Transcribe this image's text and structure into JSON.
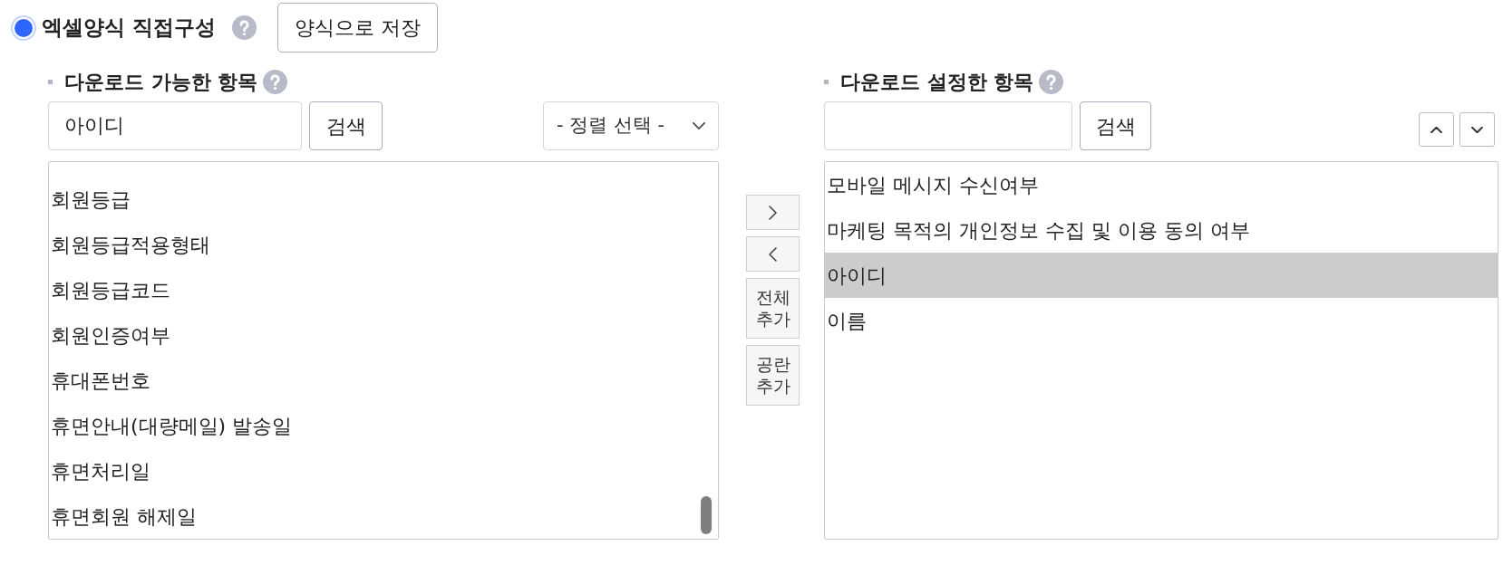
{
  "format_option": {
    "label": "엑셀양식 직접구성",
    "selected": true
  },
  "save_button": "양식으로 저장",
  "available": {
    "title": "다운로드 가능한 항목",
    "search": {
      "value": "아이디"
    },
    "search_button": "검색",
    "sort": {
      "value": "- 정렬 선택 -"
    },
    "items": [
      {
        "label": "회원등급",
        "selected": false
      },
      {
        "label": "회원등급적용형태",
        "selected": false
      },
      {
        "label": "회원등급코드",
        "selected": false
      },
      {
        "label": "회원인증여부",
        "selected": false
      },
      {
        "label": "휴대폰번호",
        "selected": false
      },
      {
        "label": "휴면안내(대량메일) 발송일",
        "selected": false
      },
      {
        "label": "휴면처리일",
        "selected": false
      },
      {
        "label": "휴면회원 해제일",
        "selected": false
      }
    ]
  },
  "transfer_buttons": [
    {
      "kind": "add"
    },
    {
      "kind": "remove"
    },
    {
      "kind": "label",
      "label": "전체 추가"
    },
    {
      "kind": "label",
      "label": "공란 추가"
    }
  ],
  "configured": {
    "title": "다운로드 설정한 항목",
    "search_button": "검색",
    "items": [
      {
        "label": "모바일 메시지 수신여부",
        "selected": false
      },
      {
        "label": "마케팅 목적의 개인정보 수집 및 이용 동의 여부",
        "selected": false
      },
      {
        "label": "아이디",
        "selected": true
      },
      {
        "label": "이름",
        "selected": false
      }
    ]
  }
}
